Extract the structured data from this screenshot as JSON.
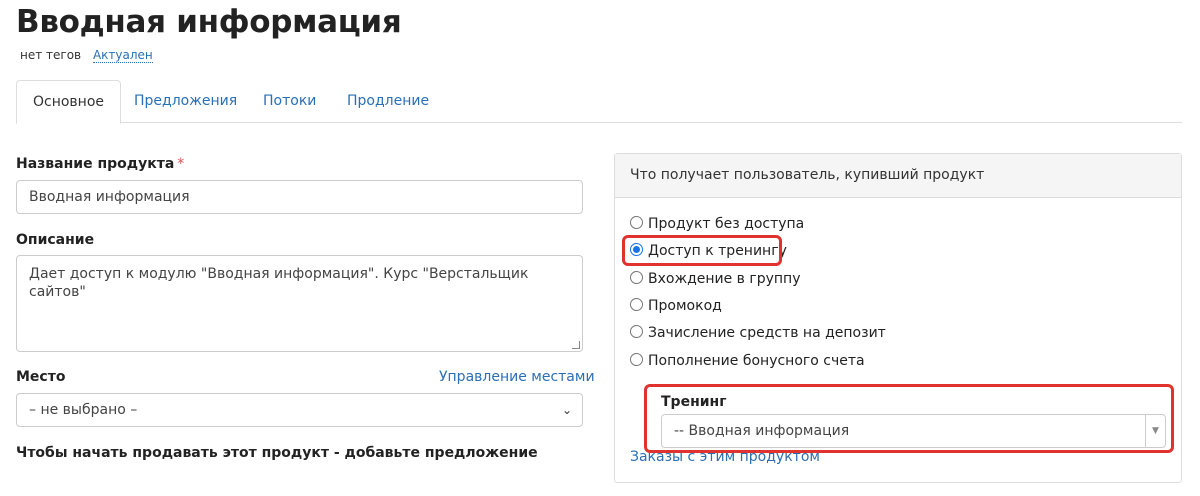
{
  "header": {
    "title": "Вводная информация",
    "tags": "нет тегов",
    "status": "Актуален"
  },
  "tabs": [
    {
      "label": "Основное",
      "active": true
    },
    {
      "label": "Предложения",
      "active": false
    },
    {
      "label": "Потоки",
      "active": false
    },
    {
      "label": "Продление",
      "active": false
    }
  ],
  "form": {
    "name_label": "Название продукта",
    "required_mark": "*",
    "name_value": "Вводная информация",
    "description_label": "Описание",
    "description_value": "Дает доступ к модулю \"Вводная информация\". Курс \"Верстальщик сайтов\"",
    "place_label": "Место",
    "place_manage_link": "Управление местами",
    "place_value": "– не выбрано –",
    "sell_hint": "Чтобы начать продавать этот продукт - добавьте предложение"
  },
  "panel": {
    "title": "Что получает пользователь, купивший продукт",
    "options": [
      {
        "label": "Продукт без доступа",
        "checked": false
      },
      {
        "label": "Доступ к тренингу",
        "checked": true
      },
      {
        "label": "Вхождение в группу",
        "checked": false
      },
      {
        "label": "Промокод",
        "checked": false
      },
      {
        "label": "Зачисление средств на депозит",
        "checked": false
      },
      {
        "label": "Пополнение бонусного счета",
        "checked": false
      }
    ],
    "training_label": "Тренинг",
    "training_value": "-- Вводная информация",
    "orders_link": "Заказы с этим продуктом"
  },
  "colors": {
    "link": "#2a6fb5",
    "highlight": "#e0322e",
    "radio_checked": "#1a73e8"
  }
}
